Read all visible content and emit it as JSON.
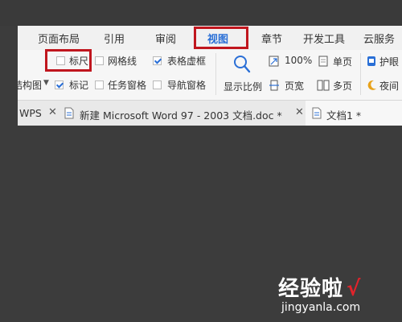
{
  "ribbon_tabs": [
    "页面布局",
    "引用",
    "审阅",
    "视图",
    "章节",
    "开发工具",
    "云服务"
  ],
  "active_tab": "视图",
  "view_panel": {
    "ruler": {
      "label": "标尺",
      "checked": false
    },
    "gridlines": {
      "label": "网格线",
      "checked": false
    },
    "table_gridlines": {
      "label": "表格虚框",
      "checked": true
    },
    "outline": {
      "label": "结构图"
    },
    "marks": {
      "label": "标记",
      "checked": true
    },
    "task_pane": {
      "label": "任务窗格",
      "checked": false
    },
    "nav_pane": {
      "label": "导航窗格",
      "checked": false
    },
    "zoom_label": "显示比例",
    "zoom_100": "100%",
    "page_width": "页宽",
    "single_page": "单页",
    "multi_page": "多页",
    "eye_protect": "护眼",
    "night_mode": "夜间"
  },
  "doc_tabs": [
    {
      "label": "WPS"
    },
    {
      "label": "新建 Microsoft Word 97 - 2003 文档.doc *"
    },
    {
      "label": "文档1 *"
    }
  ],
  "watermark": {
    "title": "经验啦",
    "check": "√",
    "url": "jingyanla.com"
  },
  "colors": {
    "highlight_box": "#c0161e",
    "accent": "#2a6fd6",
    "background": "#3c3c3c"
  }
}
